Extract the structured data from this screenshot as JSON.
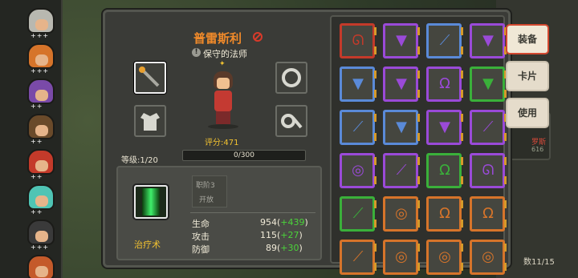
{
  "hero_list": {
    "slots": [
      {
        "hair": "#b8b8b0",
        "stars": "+++"
      },
      {
        "hair": "#d6742a",
        "stars": "+++"
      },
      {
        "hair": "#7a4aa8",
        "stars": "++"
      },
      {
        "hair": "#6a4a2a",
        "stars": "++"
      },
      {
        "hair": "#c43a2a",
        "stars": "++"
      },
      {
        "hair": "#4fc4b4",
        "stars": "++"
      },
      {
        "hair": "#3a3a3a",
        "stars": "+++"
      },
      {
        "hair": "#c45a2a",
        "stars": ""
      }
    ]
  },
  "hero": {
    "name": "普雷斯利",
    "title": "保守的法师",
    "title_icon": "!",
    "rank_star": "✦",
    "score_label": "评分:471",
    "level_label": "等级:1/20",
    "xp_text": "0/300",
    "xp_fraction": 0.0
  },
  "skill": {
    "name": "治疗术",
    "rank_line1": "职阶3",
    "rank_line2": "开放"
  },
  "stats": [
    {
      "label": "生命",
      "value": "954",
      "bonus": "+439"
    },
    {
      "label": "攻击",
      "value": "115",
      "bonus": "+27"
    },
    {
      "label": "防御",
      "value": "89",
      "bonus": "+30"
    }
  ],
  "tabs": [
    {
      "label": "装备",
      "active": true
    },
    {
      "label": "卡片",
      "active": false
    },
    {
      "label": "使用",
      "active": false
    }
  ],
  "background": {
    "behind_name": "罗斯",
    "behind_num": "616",
    "count_label": "数11/15"
  },
  "inventory": {
    "rows": [
      [
        {
          "icon": "necklace",
          "color": "#c43a2a",
          "glyph": "ᘏ"
        },
        {
          "icon": "armor",
          "color": "#9a4ad8",
          "glyph": "▼"
        },
        {
          "icon": "staff",
          "color": "#5a8ad8",
          "glyph": "⟋"
        },
        {
          "icon": "armor",
          "color": "#9a4ad8",
          "glyph": "▼"
        }
      ],
      [
        {
          "icon": "robe",
          "color": "#5a8ad8",
          "glyph": "▼"
        },
        {
          "icon": "robe",
          "color": "#9a4ad8",
          "glyph": "▼"
        },
        {
          "icon": "amulet",
          "color": "#9a4ad8",
          "glyph": "Ω"
        },
        {
          "icon": "armor",
          "color": "#3ab03a",
          "glyph": "▼"
        }
      ],
      [
        {
          "icon": "staff",
          "color": "#5a8ad8",
          "glyph": "⟋"
        },
        {
          "icon": "armor",
          "color": "#5a8ad8",
          "glyph": "▼"
        },
        {
          "icon": "robe",
          "color": "#9a4ad8",
          "glyph": "▼"
        },
        {
          "icon": "staff",
          "color": "#9a4ad8",
          "glyph": "⟋"
        }
      ],
      [
        {
          "icon": "ring",
          "color": "#9a4ad8",
          "glyph": "◎"
        },
        {
          "icon": "staff",
          "color": "#9a4ad8",
          "glyph": "⟋"
        },
        {
          "icon": "amulet",
          "color": "#3ab03a",
          "glyph": "Ω"
        },
        {
          "icon": "necklace",
          "color": "#9a4ad8",
          "glyph": "ᘏ"
        }
      ],
      [
        {
          "icon": "staff",
          "color": "#3ab03a",
          "glyph": "⟋"
        },
        {
          "icon": "ring",
          "color": "#d6742a",
          "glyph": "◎"
        },
        {
          "icon": "amulet",
          "color": "#d6742a",
          "glyph": "Ω"
        },
        {
          "icon": "amulet",
          "color": "#d6742a",
          "glyph": "Ω"
        }
      ],
      [
        {
          "icon": "staff",
          "color": "#d6742a",
          "glyph": "⟋"
        },
        {
          "icon": "ring",
          "color": "#d6742a",
          "glyph": "◎"
        },
        {
          "icon": "ring",
          "color": "#d6742a",
          "glyph": "◎"
        },
        {
          "icon": "ring",
          "color": "#d6742a",
          "glyph": "◎"
        }
      ]
    ]
  }
}
